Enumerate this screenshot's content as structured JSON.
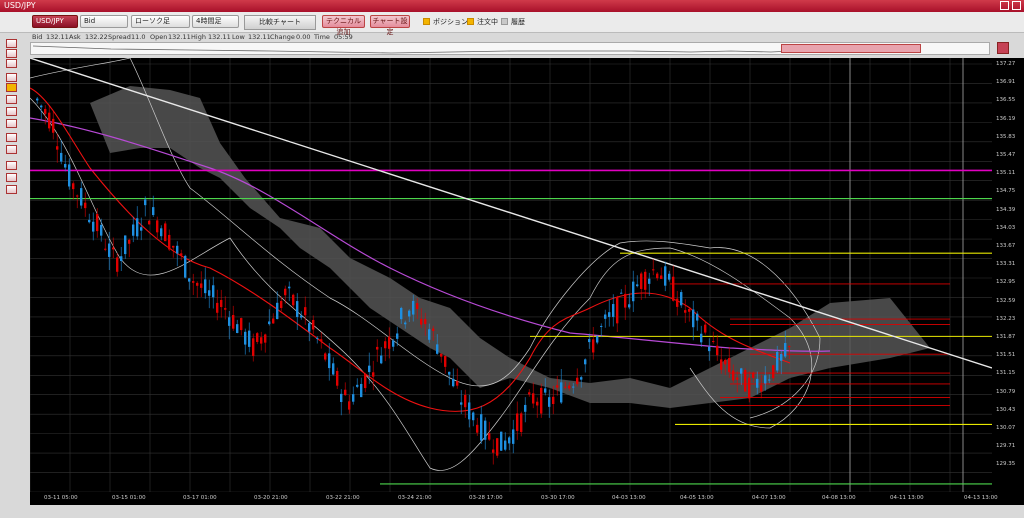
{
  "window": {
    "title": "USD/JPY"
  },
  "toolbar": {
    "pair": "USD/JPY",
    "price_type": "Bid",
    "chart_type": "ローソク足",
    "interval": "4時間足",
    "compare": "比較チャート",
    "add_technical": "テクニカル追加",
    "chart_settings": "チャート設定",
    "position": "ポジション",
    "orders": "注文中",
    "history": "履歴"
  },
  "info": {
    "bid_label": "Bid",
    "bid": "132.11",
    "ask_label": "Ask",
    "ask": "132.22",
    "spread_label": "Spread",
    "spread": "11.0",
    "open_label": "Open",
    "open": "132.11",
    "high_label": "High",
    "high": "132.11",
    "low_label": "Low",
    "low": "132.11",
    "change_label": "Change",
    "change": "0.00",
    "time_label": "Time",
    "time": "05:59"
  },
  "yaxis": [
    "137.27",
    "136.91",
    "136.55",
    "136.19",
    "135.83",
    "135.47",
    "135.11",
    "134.75",
    "134.39",
    "134.03",
    "133.67",
    "133.31",
    "132.95",
    "132.59",
    "132.23",
    "131.87",
    "131.51",
    "131.15",
    "130.79",
    "130.43",
    "130.07",
    "129.71",
    "129.35"
  ],
  "xaxis": [
    "03-11 05:00",
    "03-15 01:00",
    "03-17 01:00",
    "03-20 21:00",
    "03-22 21:00",
    "03-24 21:00",
    "03-28 17:00",
    "03-30 17:00",
    "04-03 13:00",
    "04-05 13:00",
    "04-07 13:00",
    "04-08 13:00",
    "04-11 13:00",
    "04-13 13:00"
  ],
  "colors": {
    "bull": "#1e8fe0",
    "bear": "#e00000",
    "magenta": "#e000c0",
    "green": "#4cd64c",
    "yellow": "#e8e800",
    "trend": "#e8e8e8"
  },
  "chart_data": {
    "type": "candlestick",
    "ylim": [
      129.35,
      137.27
    ],
    "candles_close_sample": [
      136.6,
      134.9,
      134.1,
      133.2,
      132.5,
      131.4,
      131.0,
      131.6,
      132.2,
      133.1,
      133.3,
      132.6,
      131.5,
      131.8,
      132.1
    ],
    "horizontal_lines": [
      {
        "name": "magenta",
        "y": 135.3
      },
      {
        "name": "green-upper",
        "y": 134.78
      },
      {
        "name": "green-lower",
        "y": 129.5
      },
      {
        "name": "yellow-1",
        "y": 133.77
      },
      {
        "name": "yellow-2",
        "y": 132.23
      },
      {
        "name": "yellow-3",
        "y": 130.6
      }
    ]
  }
}
